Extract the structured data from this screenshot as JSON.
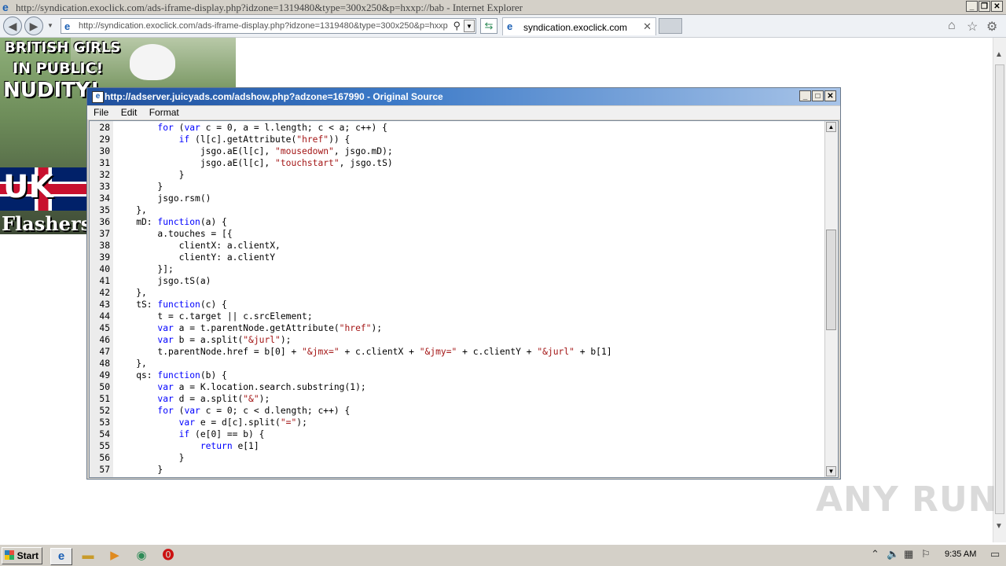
{
  "browser": {
    "window_title": "http://syndication.exoclick.com/ads-iframe-display.php?idzone=1319480&type=300x250&p=hxxp://bab - Internet Explorer",
    "address_url": "http://syndication.exoclick.com/ads-iframe-display.php?idzone=1319480&type=300x250&p=hxxp",
    "tab_label": "syndication.exoclick.com"
  },
  "ad": {
    "line1": "BRITISH GIRLS",
    "line2": "IN PUBLIC!",
    "line3": "NUDITY!",
    "flag_text": "UK",
    "brand": "Flashers"
  },
  "source_window": {
    "title": "http://adserver.juicyads.com/adshow.php?adzone=167990 - Original Source",
    "menu": [
      "File",
      "Edit",
      "Format"
    ],
    "lines": [
      {
        "n": "28",
        "code": [
          [
            "        ",
            ""
          ],
          [
            "for",
            "kw"
          ],
          [
            " (",
            ""
          ],
          [
            "var",
            "kw"
          ],
          [
            " c = 0, a = l.length; c < a; c++) {",
            ""
          ]
        ]
      },
      {
        "n": "29",
        "code": [
          [
            "            ",
            ""
          ],
          [
            "if",
            "kw"
          ],
          [
            " (l[c].getAttribute(",
            ""
          ],
          [
            "\"href\"",
            "str"
          ],
          [
            ")) {",
            ""
          ]
        ]
      },
      {
        "n": "30",
        "code": [
          [
            "                jsgo.aE(l[c], ",
            ""
          ],
          [
            "\"mousedown\"",
            "str"
          ],
          [
            ", jsgo.mD);",
            ""
          ]
        ]
      },
      {
        "n": "31",
        "code": [
          [
            "                jsgo.aE(l[c], ",
            ""
          ],
          [
            "\"touchstart\"",
            "str"
          ],
          [
            ", jsgo.tS)",
            ""
          ]
        ]
      },
      {
        "n": "32",
        "code": [
          [
            "            }",
            ""
          ]
        ]
      },
      {
        "n": "33",
        "code": [
          [
            "        }",
            ""
          ]
        ]
      },
      {
        "n": "34",
        "code": [
          [
            "        jsgo.rsm()",
            ""
          ]
        ]
      },
      {
        "n": "35",
        "code": [
          [
            "    },",
            ""
          ]
        ]
      },
      {
        "n": "36",
        "code": [
          [
            "    mD: ",
            ""
          ],
          [
            "function",
            "kw"
          ],
          [
            "(a) {",
            ""
          ]
        ]
      },
      {
        "n": "37",
        "code": [
          [
            "        a.touches = [{",
            ""
          ]
        ]
      },
      {
        "n": "38",
        "code": [
          [
            "            clientX: a.clientX,",
            ""
          ]
        ]
      },
      {
        "n": "39",
        "code": [
          [
            "            clientY: a.clientY",
            ""
          ]
        ]
      },
      {
        "n": "40",
        "code": [
          [
            "        }];",
            ""
          ]
        ]
      },
      {
        "n": "41",
        "code": [
          [
            "        jsgo.tS(a)",
            ""
          ]
        ]
      },
      {
        "n": "42",
        "code": [
          [
            "    },",
            ""
          ]
        ]
      },
      {
        "n": "43",
        "code": [
          [
            "    tS: ",
            ""
          ],
          [
            "function",
            "kw"
          ],
          [
            "(c) {",
            ""
          ]
        ]
      },
      {
        "n": "44",
        "code": [
          [
            "        t = c.target || c.srcElement;",
            ""
          ]
        ]
      },
      {
        "n": "45",
        "code": [
          [
            "        ",
            ""
          ],
          [
            "var",
            "kw"
          ],
          [
            " a = t.parentNode.getAttribute(",
            ""
          ],
          [
            "\"href\"",
            "str"
          ],
          [
            ");",
            ""
          ]
        ]
      },
      {
        "n": "46",
        "code": [
          [
            "        ",
            ""
          ],
          [
            "var",
            "kw"
          ],
          [
            " b = a.split(",
            ""
          ],
          [
            "\"&jurl\"",
            "str"
          ],
          [
            ");",
            ""
          ]
        ]
      },
      {
        "n": "47",
        "code": [
          [
            "        t.parentNode.href = b[0] + ",
            ""
          ],
          [
            "\"&jmx=\"",
            "str"
          ],
          [
            " + c.clientX + ",
            ""
          ],
          [
            "\"&jmy=\"",
            "str"
          ],
          [
            " + c.clientY + ",
            ""
          ],
          [
            "\"&jurl\"",
            "str"
          ],
          [
            " + b[1]",
            ""
          ]
        ]
      },
      {
        "n": "48",
        "code": [
          [
            "    },",
            ""
          ]
        ]
      },
      {
        "n": "49",
        "code": [
          [
            "    qs: ",
            ""
          ],
          [
            "function",
            "kw"
          ],
          [
            "(b) {",
            ""
          ]
        ]
      },
      {
        "n": "50",
        "code": [
          [
            "        ",
            ""
          ],
          [
            "var",
            "kw"
          ],
          [
            " a = K.location.search.substring(1);",
            ""
          ]
        ]
      },
      {
        "n": "51",
        "code": [
          [
            "        ",
            ""
          ],
          [
            "var",
            "kw"
          ],
          [
            " d = a.split(",
            ""
          ],
          [
            "\"&\"",
            "str"
          ],
          [
            ");",
            ""
          ]
        ]
      },
      {
        "n": "52",
        "code": [
          [
            "        ",
            ""
          ],
          [
            "for",
            "kw"
          ],
          [
            " (",
            ""
          ],
          [
            "var",
            "kw"
          ],
          [
            " c = 0; c < d.length; c++) {",
            ""
          ]
        ]
      },
      {
        "n": "53",
        "code": [
          [
            "            ",
            ""
          ],
          [
            "var",
            "kw"
          ],
          [
            " e = d[c].split(",
            ""
          ],
          [
            "\"=\"",
            "str"
          ],
          [
            ");",
            ""
          ]
        ]
      },
      {
        "n": "54",
        "code": [
          [
            "            ",
            ""
          ],
          [
            "if",
            "kw"
          ],
          [
            " (e[0] == b) {",
            ""
          ]
        ]
      },
      {
        "n": "55",
        "code": [
          [
            "                ",
            ""
          ],
          [
            "return",
            "kw"
          ],
          [
            " e[1]",
            ""
          ]
        ]
      },
      {
        "n": "56",
        "code": [
          [
            "            }",
            ""
          ]
        ]
      },
      {
        "n": "57",
        "code": [
          [
            "        }",
            ""
          ]
        ]
      }
    ]
  },
  "watermark": "ANY RUN",
  "taskbar": {
    "start_label": "Start",
    "clock": "9:35 AM"
  }
}
